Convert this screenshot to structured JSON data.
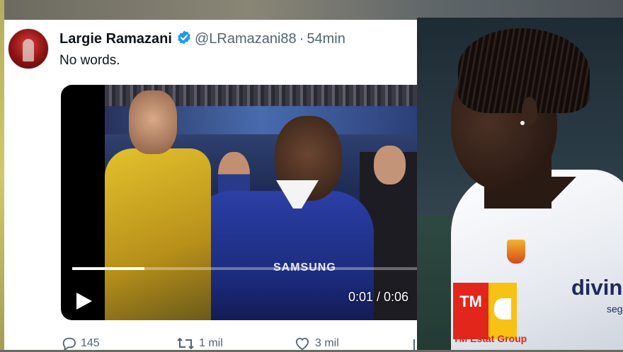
{
  "tweet": {
    "display_name": "Largie Ramazani",
    "handle": "@LRamazani88",
    "separator": "·",
    "time": "54min",
    "text": "No words.",
    "verified_color": "#1d9bf0",
    "video": {
      "time": "0:01 / 0:06",
      "progress": 0.21,
      "overlay_text": "SAMSUNG"
    },
    "actions": {
      "replies": "145",
      "retweets": "1 mil",
      "likes": "3 mil"
    }
  },
  "photo": {
    "sponsor_left": "TM",
    "sponsor_left_sub": "TM Estat Group",
    "sponsor_right": "divin",
    "sponsor_right_sub": "seg"
  },
  "colors": {
    "text_primary": "#0f1419",
    "text_secondary": "#536471",
    "accent": "#1d9bf0"
  }
}
